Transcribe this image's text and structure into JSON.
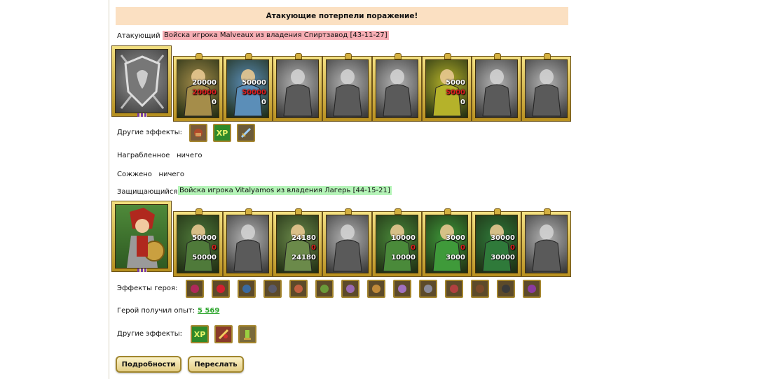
{
  "banner": "Атакующие потерпели поражение!",
  "attacker": {
    "label": "Атакующий",
    "army": "Войска игрока Malveaux из владения Спиртзавод [43-11-27]",
    "units": [
      {
        "name": "unit-dwarf",
        "stack": "20000",
        "lost": "20000",
        "left": "0",
        "color": "#a58d4a",
        "grey": false
      },
      {
        "name": "unit-paladin",
        "stack": "50000",
        "lost": "50000",
        "left": "0",
        "color": "#5b8eb8",
        "grey": false
      },
      {
        "name": "unit-knight",
        "stack": "",
        "lost": "",
        "left": "",
        "color": "#8a8a8a",
        "grey": true
      },
      {
        "name": "unit-griffin",
        "stack": "",
        "lost": "",
        "left": "",
        "color": "#7a7a7a",
        "grey": true
      },
      {
        "name": "unit-crossbowman",
        "stack": "",
        "lost": "",
        "left": "",
        "color": "#858585",
        "grey": true
      },
      {
        "name": "unit-monk",
        "stack": "5000",
        "lost": "5000",
        "left": "0",
        "color": "#b5b22a",
        "grey": false
      },
      {
        "name": "unit-swordsman",
        "stack": "",
        "lost": "",
        "left": "",
        "color": "#6e6e6e",
        "grey": true
      },
      {
        "name": "unit-champion",
        "stack": "",
        "lost": "",
        "left": "",
        "color": "#808080",
        "grey": true
      }
    ],
    "other_effects_label": "Другие эффекты:",
    "other_effects": [
      "helmet-icon",
      "xp-icon",
      "sword-icon"
    ]
  },
  "looted": {
    "label": "Награбленное",
    "value": "ничего"
  },
  "burned": {
    "label": "Сожжено",
    "value": "ничего"
  },
  "defender": {
    "label": "Защищающийся",
    "army": "Войска игрока Vitalyamos из владения Лагерь [44-15-21]",
    "units": [
      {
        "name": "unit-dwarf-warrior",
        "stack": "50000",
        "lost": "0",
        "left": "50000",
        "color": "#4f7a3a",
        "grey": false
      },
      {
        "name": "unit-dark-knight",
        "stack": "",
        "lost": "",
        "left": "",
        "color": "#555555",
        "grey": true
      },
      {
        "name": "unit-elf-spearman",
        "stack": "24180",
        "lost": "0",
        "left": "24180",
        "color": "#6b8a4a",
        "grey": false
      },
      {
        "name": "unit-gargoyle",
        "stack": "",
        "lost": "",
        "left": "",
        "color": "#6a6a6a",
        "grey": true
      },
      {
        "name": "unit-elf-archer",
        "stack": "10000",
        "lost": "0",
        "left": "10000",
        "color": "#4a8a3a",
        "grey": false
      },
      {
        "name": "unit-druid",
        "stack": "3000",
        "lost": "0",
        "left": "3000",
        "color": "#3f9a3a",
        "grey": false
      },
      {
        "name": "unit-ranger",
        "stack": "30000",
        "lost": "0",
        "left": "30000",
        "color": "#2f7a3a",
        "grey": false
      },
      {
        "name": "unit-treant",
        "stack": "",
        "lost": "",
        "left": "",
        "color": "#707070",
        "grey": true
      }
    ],
    "hero_effects_label": "Эффекты героя:",
    "hero_effects": [
      "chest-icon",
      "heart-icon",
      "shield-icon",
      "armor-icon",
      "horn-icon",
      "potion-icon",
      "wings-icon",
      "candles-icon",
      "ring-icon",
      "hammer-icon",
      "spider-icon",
      "scroll-icon",
      "cloak-icon",
      "swords-icon"
    ],
    "exp_label": "Герой получил опыт:",
    "exp_value": "5 569",
    "other_effects_label": "Другие эффекты:",
    "other_effects": [
      "xp-icon",
      "sword-icon",
      "tower-icon"
    ]
  },
  "buttons": {
    "details": "Подробности",
    "forward": "Переслать"
  },
  "colors": {
    "banner": "#fbe0c2",
    "attacker_bg": "#f7aeb4",
    "defender_bg": "#b5f4b8",
    "gold_frame": "#c9a73a"
  }
}
